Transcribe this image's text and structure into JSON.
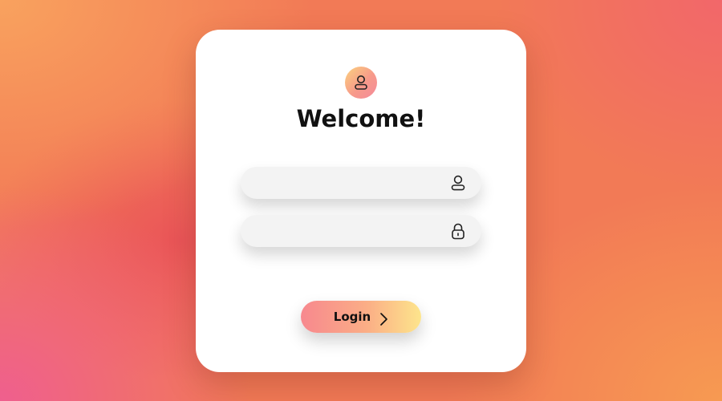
{
  "login_form": {
    "title": "Welcome!",
    "username": {
      "value": "",
      "placeholder": "",
      "icon": "user-icon"
    },
    "password": {
      "value": "",
      "placeholder": "",
      "icon": "lock-icon"
    },
    "submit_label": "Login",
    "submit_icon": "chevron-right-icon",
    "avatar_icon": "user-icon"
  },
  "colors": {
    "card_background": "#ffffff",
    "field_background": "#f3f3f3",
    "button_gradient_start": "#f7888e",
    "button_gradient_end": "#fde58c",
    "avatar_gradient_start": "#fbd27e",
    "avatar_gradient_end": "#f48a9a",
    "text": "#111111"
  }
}
